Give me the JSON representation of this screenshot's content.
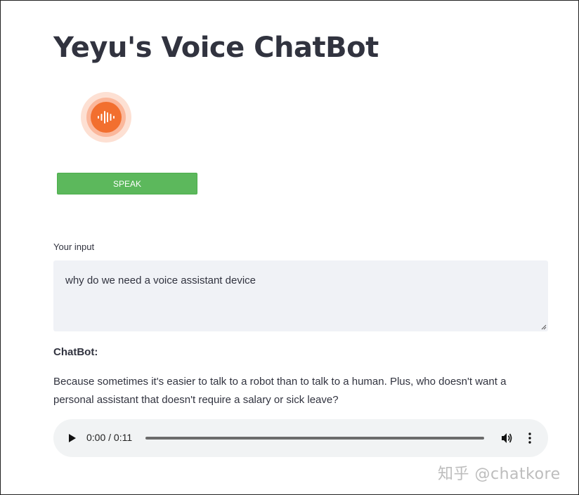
{
  "app": {
    "title": "Yeyu's Voice ChatBot"
  },
  "recorder": {
    "icon": "audio-wave-icon",
    "accent_color": "#f26f2f",
    "speak_label": "SPEAK",
    "speak_color": "#5cb85c"
  },
  "input": {
    "label": "Your input",
    "value": "why do we need a voice assistant device"
  },
  "chat": {
    "label": "ChatBot:",
    "response": "Because sometimes it's easier to talk to a robot than to talk to a human. Plus, who doesn't want a personal assistant that doesn't require a salary or sick leave?"
  },
  "audio_player": {
    "time": "0:00 / 0:11",
    "progress": 0,
    "icons": [
      "play-icon",
      "volume-icon",
      "more-options-icon"
    ]
  },
  "watermark": {
    "text": "知乎 @chatkore"
  }
}
